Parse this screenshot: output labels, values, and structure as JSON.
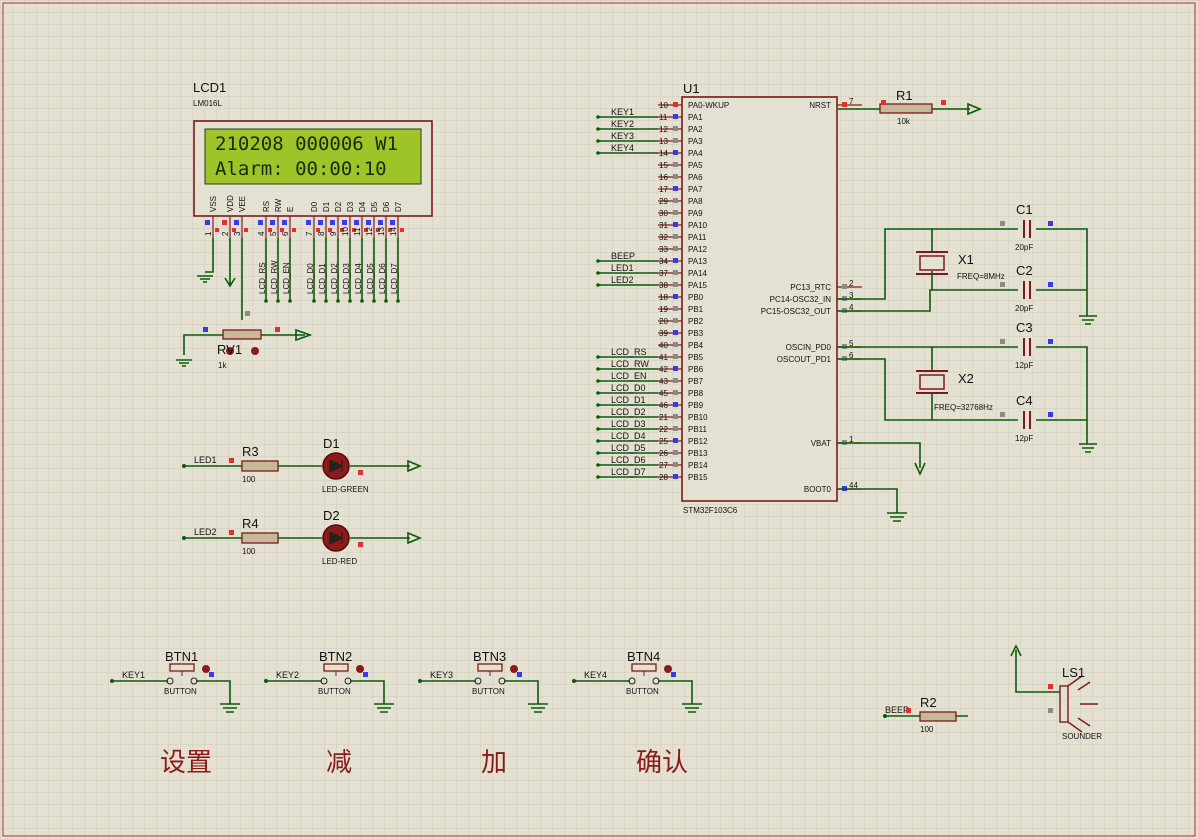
{
  "lcd": {
    "ref": "LCD1",
    "model": "LM016L",
    "line1": "210208 000006 W1",
    "line2": "Alarm: 00:00:10",
    "pins": [
      "VSS",
      "VDD",
      "VEE",
      "RS",
      "RW",
      "E",
      "D0",
      "D1",
      "D2",
      "D3",
      "D4",
      "D5",
      "D6",
      "D7"
    ],
    "pinnums": [
      "1",
      "2",
      "3",
      "4",
      "5",
      "6",
      "7",
      "8",
      "9",
      "10",
      "11",
      "12",
      "13",
      "14"
    ],
    "nets": [
      "LCD_RS",
      "LCD_RW",
      "LCD_EN",
      "LCD_D0",
      "LCD_D1",
      "LCD_D2",
      "LCD_D3",
      "LCD_D4",
      "LCD_D5",
      "LCD_D6",
      "LCD_D7"
    ]
  },
  "rv1": {
    "ref": "RV1",
    "value": "1k"
  },
  "mcu": {
    "ref": "U1",
    "model": "STM32F103C6",
    "left_pins": [
      {
        "num": "10",
        "name": "PA0-WKUP",
        "net": ""
      },
      {
        "num": "11",
        "name": "PA1",
        "net": "KEY1"
      },
      {
        "num": "12",
        "name": "PA2",
        "net": "KEY2"
      },
      {
        "num": "13",
        "name": "PA3",
        "net": "KEY3"
      },
      {
        "num": "14",
        "name": "PA4",
        "net": "KEY4"
      },
      {
        "num": "15",
        "name": "PA5",
        "net": ""
      },
      {
        "num": "16",
        "name": "PA6",
        "net": ""
      },
      {
        "num": "17",
        "name": "PA7",
        "net": ""
      },
      {
        "num": "29",
        "name": "PA8",
        "net": ""
      },
      {
        "num": "30",
        "name": "PA9",
        "net": ""
      },
      {
        "num": "31",
        "name": "PA10",
        "net": ""
      },
      {
        "num": "32",
        "name": "PA11",
        "net": ""
      },
      {
        "num": "33",
        "name": "PA12",
        "net": ""
      },
      {
        "num": "34",
        "name": "PA13",
        "net": "BEEP"
      },
      {
        "num": "37",
        "name": "PA14",
        "net": "LED1"
      },
      {
        "num": "38",
        "name": "PA15",
        "net": "LED2"
      },
      {
        "num": "18",
        "name": "PB0",
        "net": ""
      },
      {
        "num": "19",
        "name": "PB1",
        "net": ""
      },
      {
        "num": "20",
        "name": "PB2",
        "net": ""
      },
      {
        "num": "39",
        "name": "PB3",
        "net": ""
      },
      {
        "num": "40",
        "name": "PB4",
        "net": ""
      },
      {
        "num": "41",
        "name": "PB5",
        "net": "LCD_RS"
      },
      {
        "num": "42",
        "name": "PB6",
        "net": "LCD_RW"
      },
      {
        "num": "43",
        "name": "PB7",
        "net": "LCD_EN"
      },
      {
        "num": "45",
        "name": "PB8",
        "net": "LCD_D0"
      },
      {
        "num": "46",
        "name": "PB9",
        "net": "LCD_D1"
      },
      {
        "num": "21",
        "name": "PB10",
        "net": "LCD_D2"
      },
      {
        "num": "22",
        "name": "PB11",
        "net": "LCD_D3"
      },
      {
        "num": "25",
        "name": "PB12",
        "net": "LCD_D4"
      },
      {
        "num": "26",
        "name": "PB13",
        "net": "LCD_D5"
      },
      {
        "num": "27",
        "name": "PB14",
        "net": "LCD_D6"
      },
      {
        "num": "28",
        "name": "PB15",
        "net": "LCD_D7"
      }
    ],
    "right_pins": [
      {
        "num": "7",
        "name": "NRST"
      },
      {
        "num": "2",
        "name": "PC13_RTC"
      },
      {
        "num": "3",
        "name": "PC14-OSC32_IN"
      },
      {
        "num": "4",
        "name": "PC15-OSC32_OUT"
      },
      {
        "num": "5",
        "name": "OSCIN_PD0"
      },
      {
        "num": "6",
        "name": "OSCOUT_PD1"
      },
      {
        "num": "1",
        "name": "VBAT"
      },
      {
        "num": "44",
        "name": "BOOT0"
      }
    ]
  },
  "r1": {
    "ref": "R1",
    "value": "10k"
  },
  "caps": [
    {
      "ref": "C1",
      "value": "20pF"
    },
    {
      "ref": "C2",
      "value": "20pF"
    },
    {
      "ref": "C3",
      "value": "12pF"
    },
    {
      "ref": "C4",
      "value": "12pF"
    }
  ],
  "x1": {
    "ref": "X1",
    "freq": "FREQ=8MHz"
  },
  "x2": {
    "ref": "X2",
    "freq": "FREQ=32768Hz"
  },
  "leds": [
    {
      "net": "LED1",
      "rref": "R3",
      "rval": "100",
      "ref": "D1",
      "type": "LED-GREEN"
    },
    {
      "net": "LED2",
      "rref": "R4",
      "rval": "100",
      "ref": "D2",
      "type": "LED-RED"
    }
  ],
  "buttons": [
    {
      "ref": "BTN1",
      "net": "KEY1",
      "type": "BUTTON",
      "caption": "设置"
    },
    {
      "ref": "BTN2",
      "net": "KEY2",
      "type": "BUTTON",
      "caption": "减"
    },
    {
      "ref": "BTN3",
      "net": "KEY3",
      "type": "BUTTON",
      "caption": "加"
    },
    {
      "ref": "BTN4",
      "net": "KEY4",
      "type": "BUTTON",
      "caption": "确认"
    }
  ],
  "r2": {
    "ref": "R2",
    "value": "100",
    "net": "BEEP"
  },
  "ls1": {
    "ref": "LS1",
    "type": "SOUNDER"
  },
  "colors": {
    "background": "#e4e1d2",
    "grid": "#cfcbb8",
    "wire": "#0a5a0a",
    "component": "#8b1a1a",
    "lcd_screen": "#9fc42a",
    "lcd_text": "#1b2a06"
  }
}
